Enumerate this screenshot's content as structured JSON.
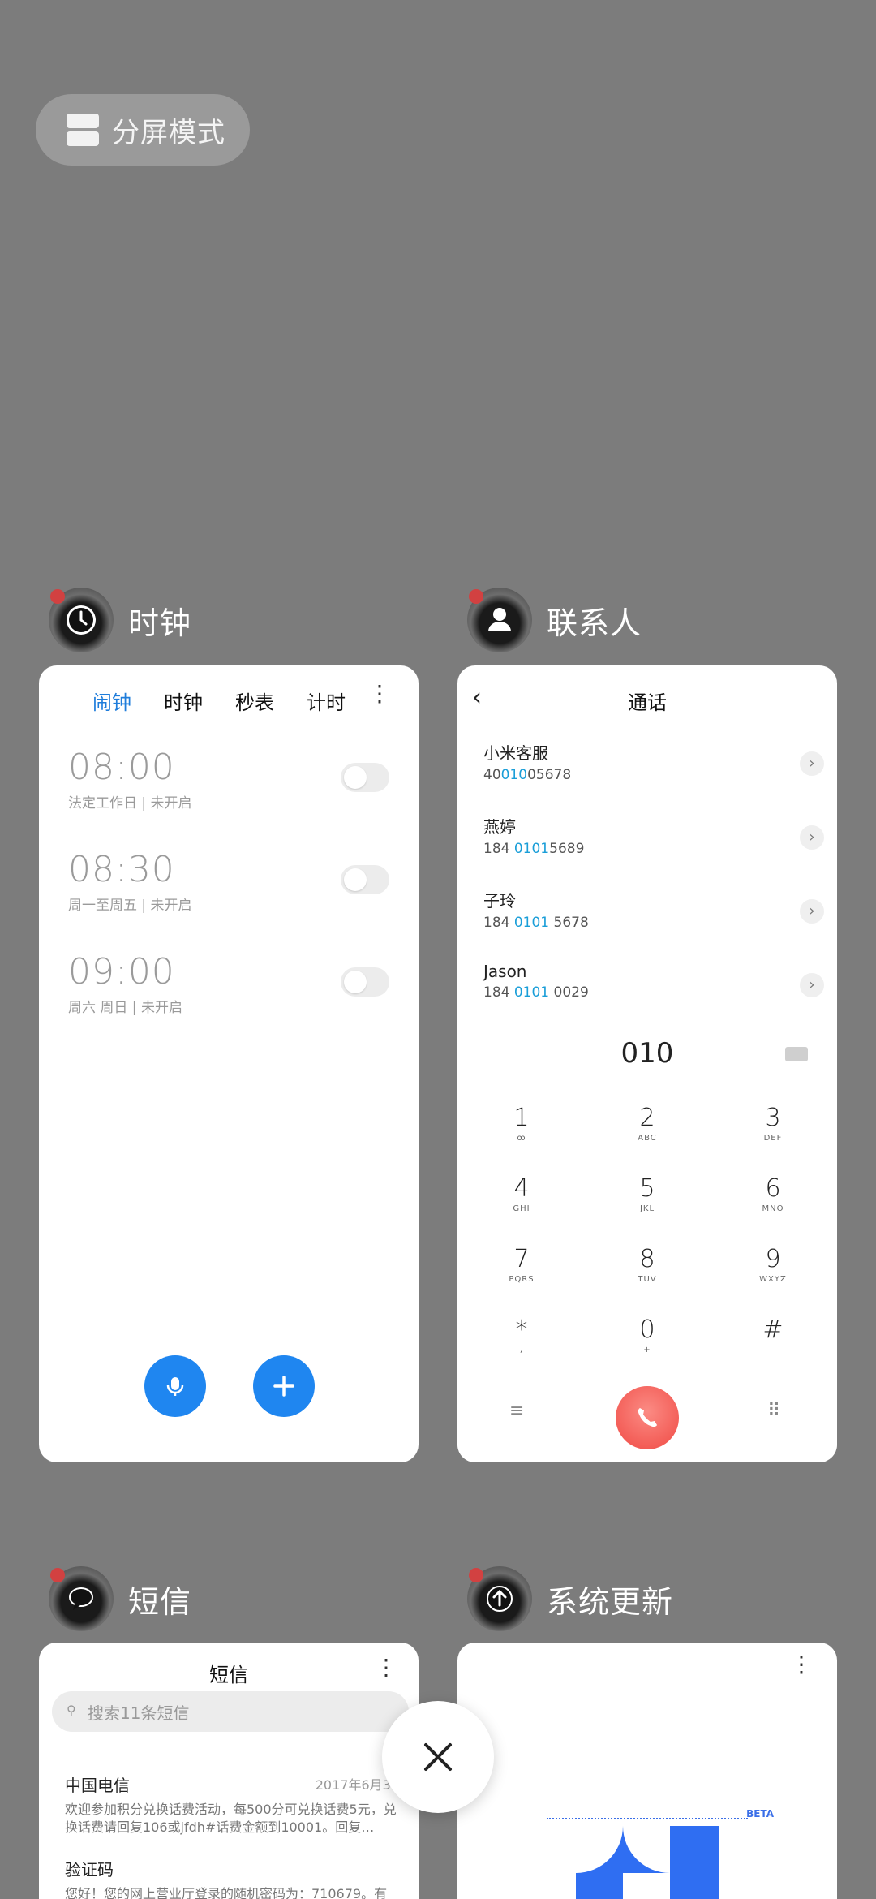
{
  "split_screen": {
    "label": "分屏模式"
  },
  "apps": [
    {
      "name": "时钟",
      "icon": "clock-icon",
      "tabs": [
        "闹钟",
        "时钟",
        "秒表",
        "计时"
      ],
      "alarms": [
        {
          "time": "08:00",
          "desc": "法定工作日 | 未开启"
        },
        {
          "time": "08:30",
          "desc": "周一至周五 | 未开启"
        },
        {
          "time": "09:00",
          "desc": "周六 周日 | 未开启"
        }
      ]
    },
    {
      "name": "联系人",
      "icon": "contact-icon",
      "title": "通话",
      "contacts": [
        {
          "name": "小米客服",
          "pre": "40",
          "hl": "010",
          "post": "05678"
        },
        {
          "name": "燕婷",
          "pre": "184 ",
          "hl": "0101",
          "post": "5689"
        },
        {
          "name": "子玲",
          "pre": "184 ",
          "hl": "0101",
          "post": " 5678"
        },
        {
          "name": "Jason",
          "pre": "184 ",
          "hl": "0101",
          "post": " 0029"
        }
      ],
      "dial_number": "010",
      "keys": [
        {
          "digit": "1",
          "letters": "ꝏ"
        },
        {
          "digit": "2",
          "letters": "ABC"
        },
        {
          "digit": "3",
          "letters": "DEF"
        },
        {
          "digit": "4",
          "letters": "GHI"
        },
        {
          "digit": "5",
          "letters": "JKL"
        },
        {
          "digit": "6",
          "letters": "MNO"
        },
        {
          "digit": "7",
          "letters": "PQRS"
        },
        {
          "digit": "8",
          "letters": "TUV"
        },
        {
          "digit": "9",
          "letters": "WXYZ"
        },
        {
          "digit": "*",
          "letters": ","
        },
        {
          "digit": "0",
          "letters": "+"
        },
        {
          "digit": "#",
          "letters": ""
        }
      ]
    },
    {
      "name": "短信",
      "icon": "message-icon",
      "title": "短信",
      "search_placeholder": "搜索11条短信",
      "messages": [
        {
          "sender": "中国电信",
          "date": "2017年6月30",
          "body": "欢迎参加积分兑换话费活动，每500分可兑换话费5元，兑换话费请回复106或jfdh#话费金额到10001。回复…"
        },
        {
          "sender": "验证码",
          "date": "",
          "body": "您好！您的网上营业厅登录的随机密码为：710679。有"
        }
      ]
    },
    {
      "name": "系统更新",
      "icon": "update-arrow-icon",
      "badge": "BETA"
    }
  ],
  "colors": {
    "background": "#7c7c7c",
    "accent": "#1f86f0",
    "call": "#f04a44"
  }
}
